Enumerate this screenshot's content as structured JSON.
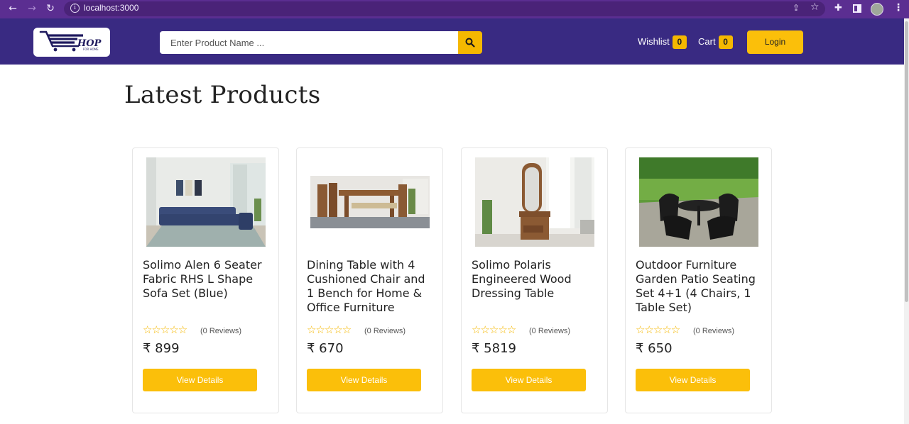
{
  "browser": {
    "url": "localhost:3000",
    "icons": [
      "back-arrow-icon",
      "forward-arrow-icon",
      "reload-icon",
      "info-icon",
      "share-icon",
      "star-icon",
      "puzzle-icon",
      "split-view-icon",
      "profile-avatar",
      "kebab-menu-icon"
    ]
  },
  "header": {
    "logo_text": "HOP",
    "logo_subtext": "FOR HOME",
    "search_placeholder": "Enter Product Name ...",
    "wishlist_label": "Wishlist",
    "wishlist_count": "0",
    "cart_label": "Cart",
    "cart_count": "0",
    "login_label": "Login",
    "colors": {
      "header_bg": "#392a82",
      "accent": "#fbbf0a",
      "browser_bg": "#5b2e91"
    }
  },
  "main": {
    "title": "Latest Products",
    "products": [
      {
        "name": "Solimo Alen 6 Seater Fabric RHS L Shape Sofa Set (Blue)",
        "stars": "☆☆☆☆☆",
        "reviews": "(0 Reviews)",
        "price": "₹ 899",
        "button": "View Details",
        "image": "sofa-image"
      },
      {
        "name": "Dining Table with 4 Cushioned Chair and 1 Bench for Home & Office Furniture",
        "stars": "☆☆☆☆☆",
        "reviews": "(0 Reviews)",
        "price": "₹ 670",
        "button": "View Details",
        "image": "dining-table-image"
      },
      {
        "name": "Solimo Polaris Engineered Wood Dressing Table",
        "stars": "☆☆☆☆☆",
        "reviews": "(0 Reviews)",
        "price": "₹ 5819",
        "button": "View Details",
        "image": "dressing-table-image"
      },
      {
        "name": "Outdoor Furniture Garden Patio Seating Set 4+1 (4 Chairs, 1 Table Set)",
        "stars": "☆☆☆☆☆",
        "reviews": "(0 Reviews)",
        "price": "₹ 650",
        "button": "View Details",
        "image": "patio-set-image"
      }
    ]
  }
}
